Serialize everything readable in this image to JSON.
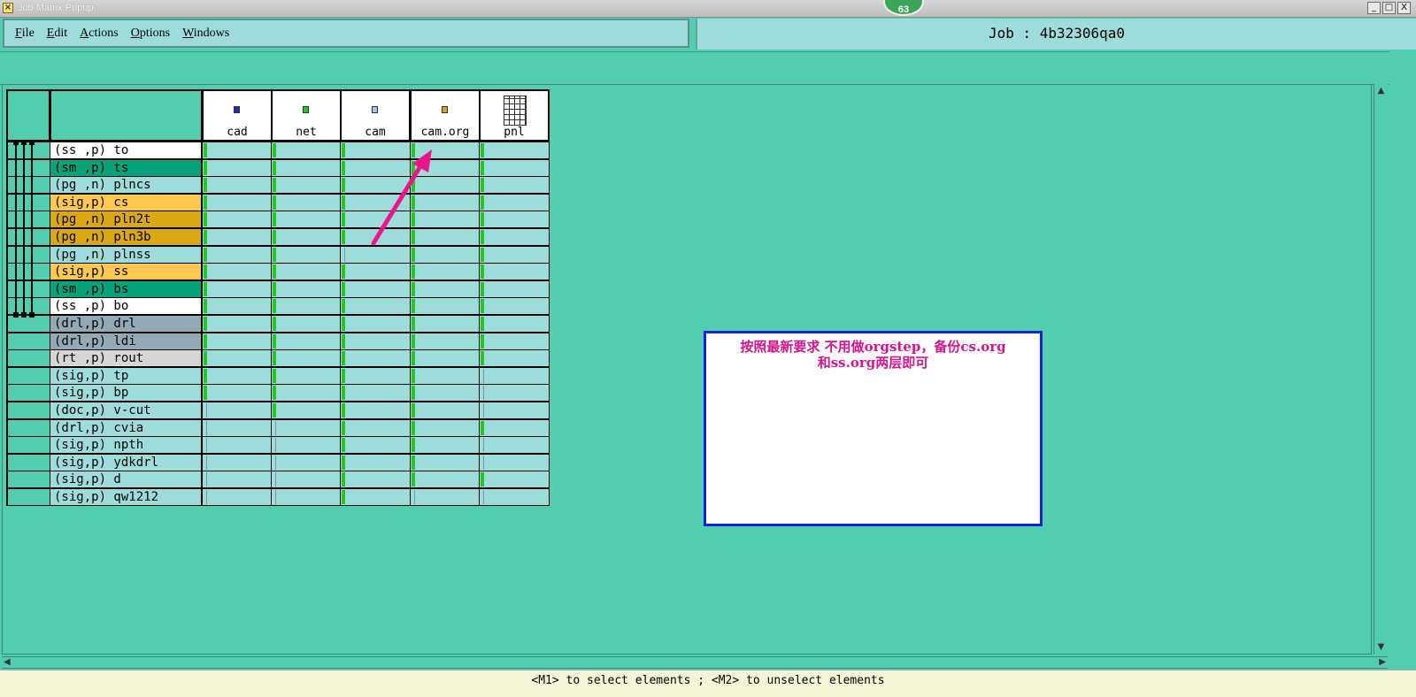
{
  "window": {
    "title": "Job Matrix Popup",
    "badge": "63",
    "controls": [
      "_",
      "□",
      "X"
    ]
  },
  "menu": {
    "items": [
      {
        "label": "File",
        "mnemonic": "F",
        "rest": "ile"
      },
      {
        "label": "Edit",
        "mnemonic": "E",
        "rest": "dit"
      },
      {
        "label": "Actions",
        "mnemonic": "A",
        "rest": "ctions"
      },
      {
        "label": "Options",
        "mnemonic": "O",
        "rest": "ptions"
      },
      {
        "label": "Windows",
        "mnemonic": "W",
        "rest": "indows"
      }
    ]
  },
  "job": {
    "label": "Job : 4b32306qa0"
  },
  "matrix": {
    "steps": [
      {
        "name": "cad",
        "icon_color": "#1a2bd0"
      },
      {
        "name": "net",
        "icon_color": "#22c81e"
      },
      {
        "name": "cam",
        "icon_color": "#9ec8e8"
      },
      {
        "name": "cam.org",
        "icon_color": "#d8a020"
      },
      {
        "name": "pnl",
        "icon": "grid-icon"
      }
    ],
    "layers": [
      {
        "label": "(ss ,p) to",
        "color": "#ffffff",
        "marks": [
          1,
          1,
          1,
          1,
          1
        ]
      },
      {
        "label": "(sm ,p) ts",
        "color": "#06a27a",
        "marks": [
          1,
          1,
          1,
          1,
          1
        ]
      },
      {
        "label": "(pg ,n) plncs",
        "color": "#9edcdc",
        "marks": [
          1,
          1,
          1,
          1,
          1
        ]
      },
      {
        "label": "(sig,p) cs",
        "color": "#ffc850",
        "marks": [
          1,
          1,
          1,
          1,
          1
        ]
      },
      {
        "label": "(pg ,n) pln2t",
        "color": "#d9a812",
        "marks": [
          1,
          1,
          1,
          1,
          1
        ]
      },
      {
        "label": "(pg ,n) pln3b",
        "color": "#d9a812",
        "marks": [
          1,
          1,
          1,
          1,
          1
        ]
      },
      {
        "label": "(pg ,n) plnss",
        "color": "#9edcdc",
        "marks": [
          1,
          1,
          0,
          1,
          1
        ]
      },
      {
        "label": "(sig,p) ss",
        "color": "#ffc850",
        "marks": [
          1,
          1,
          1,
          1,
          1
        ]
      },
      {
        "label": "(sm ,p) bs",
        "color": "#06a27a",
        "marks": [
          1,
          1,
          1,
          1,
          1
        ]
      },
      {
        "label": "(ss ,p) bo",
        "color": "#ffffff",
        "marks": [
          1,
          1,
          1,
          1,
          1
        ]
      },
      {
        "label": "(drl,p) drl",
        "color": "#93aab5",
        "marks": [
          1,
          1,
          1,
          1,
          1
        ]
      },
      {
        "label": "(drl,p) ldi",
        "color": "#93aab5",
        "marks": [
          1,
          1,
          1,
          1,
          1
        ]
      },
      {
        "label": "(rt ,p) rout",
        "color": "#d6d6d6",
        "marks": [
          1,
          1,
          1,
          1,
          1
        ]
      },
      {
        "label": "(sig,p) tp",
        "color": "#9edcdc",
        "marks": [
          1,
          1,
          1,
          1,
          0
        ]
      },
      {
        "label": "(sig,p) bp",
        "color": "#9edcdc",
        "marks": [
          1,
          1,
          1,
          1,
          0
        ]
      },
      {
        "label": "(doc,p) v-cut",
        "color": "#9edcdc",
        "marks": [
          0,
          1,
          1,
          1,
          0
        ]
      },
      {
        "label": "(drl,p) cvia",
        "color": "#9edcdc",
        "marks": [
          0,
          0,
          1,
          1,
          1
        ]
      },
      {
        "label": "(sig,p) npth",
        "color": "#9edcdc",
        "marks": [
          0,
          0,
          1,
          1,
          0
        ]
      },
      {
        "label": "(sig,p) ydkdrl",
        "color": "#9edcdc",
        "marks": [
          0,
          0,
          1,
          1,
          0
        ]
      },
      {
        "label": "(sig,p) d",
        "color": "#9edcdc",
        "marks": [
          0,
          0,
          1,
          1,
          1
        ]
      },
      {
        "label": "(sig,p) qw1212",
        "color": "#9edcdc",
        "marks": [
          0,
          0,
          1,
          0,
          0
        ]
      }
    ]
  },
  "note": {
    "line1": "按照最新要求  不用做orgstep，备份cs.org",
    "line2": "和ss.org两层即可"
  },
  "status": {
    "text": "<M1> to select elements ; <M2> to unselect elements"
  },
  "colors": {
    "background": "#52cdb0",
    "cell": "#9edcdc",
    "mark": "#22c81e",
    "arrow": "#f0148c"
  }
}
